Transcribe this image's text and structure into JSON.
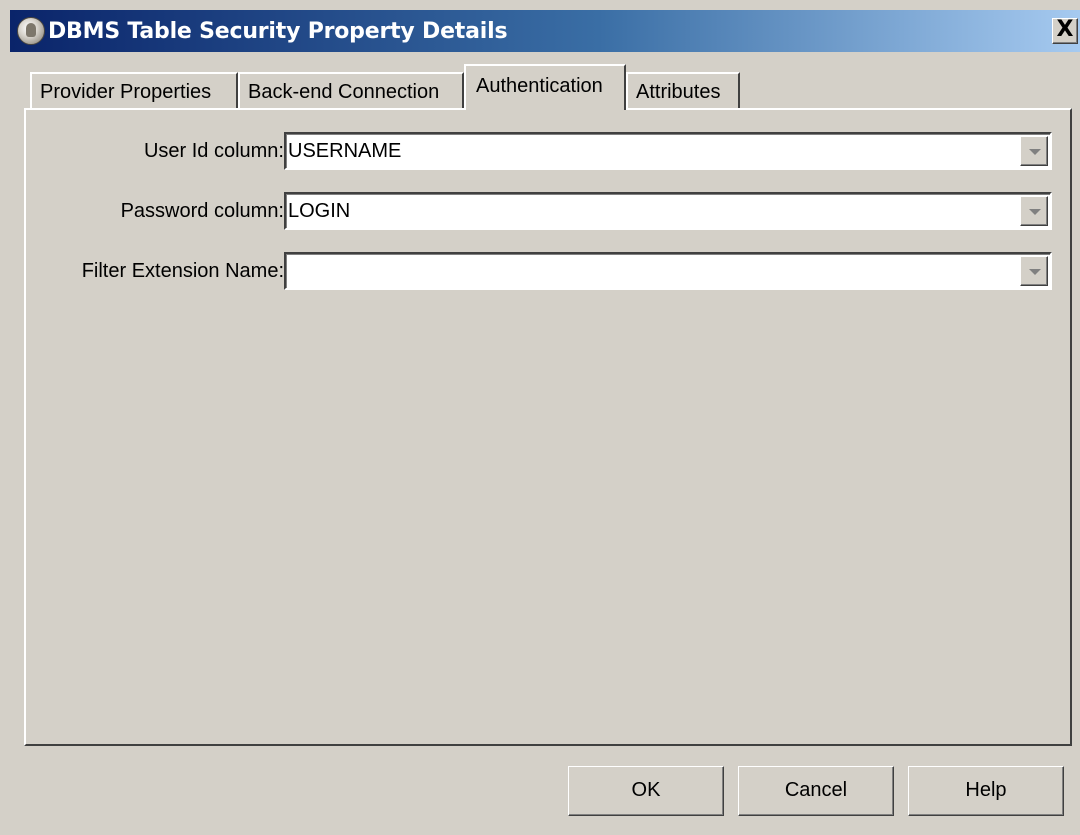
{
  "window": {
    "title": "DBMS Table Security Property Details",
    "close_label": "X"
  },
  "tabs": [
    {
      "label": "Provider Properties",
      "active": false
    },
    {
      "label": "Back-end Connection",
      "active": false
    },
    {
      "label": "Authentication",
      "active": true
    },
    {
      "label": "Attributes",
      "active": false
    }
  ],
  "form": {
    "user_id_label": "User Id column:",
    "user_id_value": "USERNAME",
    "password_label": "Password column:",
    "password_value": "LOGIN",
    "filter_label": "Filter Extension Name:",
    "filter_value": ""
  },
  "buttons": {
    "ok": "OK",
    "cancel": "Cancel",
    "help": "Help"
  },
  "colors": {
    "titlebar_start": "#0a246a",
    "titlebar_end": "#a6caf0",
    "dialog_bg": "#d4d0c8"
  }
}
